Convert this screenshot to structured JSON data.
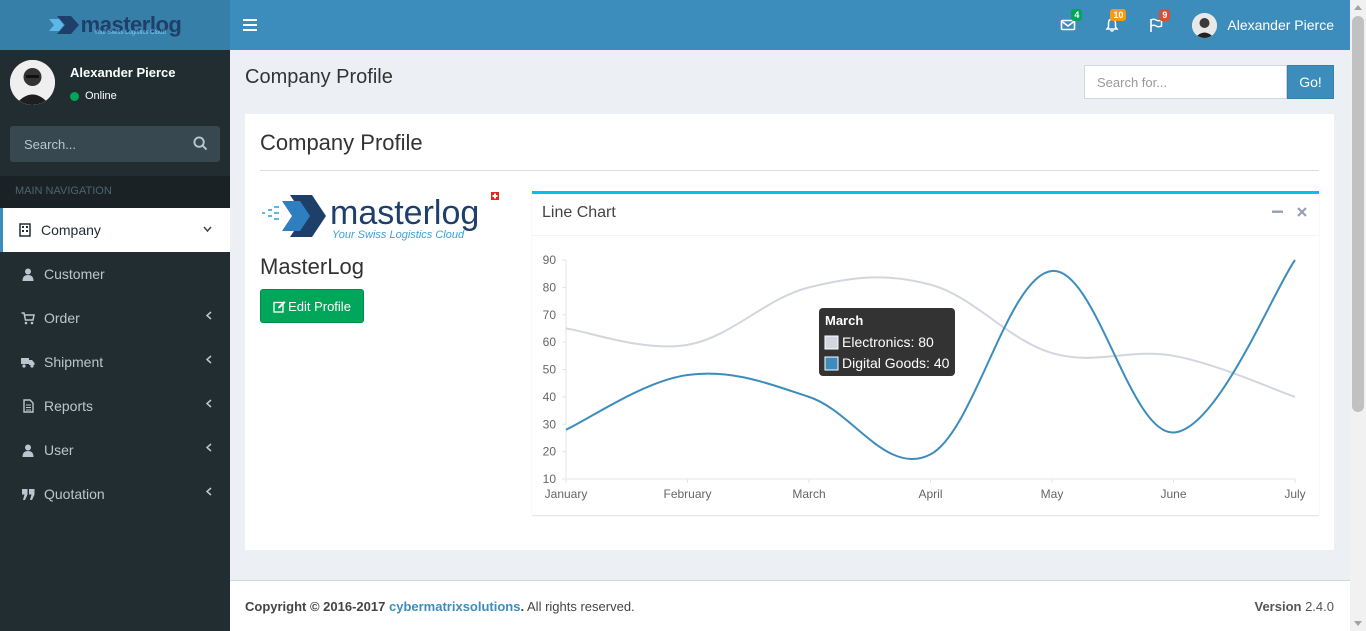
{
  "brand": {
    "name": "masterlog",
    "tagline": "Your Swiss Logistics Cloud"
  },
  "header": {
    "messages_count": "4",
    "notifications_count": "10",
    "flags_count": "9",
    "user_name": "Alexander Pierce"
  },
  "sidebar": {
    "user_name": "Alexander Pierce",
    "status": "Online",
    "search_placeholder": "Search...",
    "nav_header": "MAIN NAVIGATION",
    "items": [
      {
        "label": "Company",
        "icon": "building-icon",
        "active": true
      },
      {
        "label": "Customer",
        "icon": "user-icon"
      },
      {
        "label": "Order",
        "icon": "cart-icon"
      },
      {
        "label": "Shipment",
        "icon": "truck-icon"
      },
      {
        "label": "Reports",
        "icon": "document-icon"
      },
      {
        "label": "User",
        "icon": "user-icon"
      },
      {
        "label": "Quotation",
        "icon": "quote-icon"
      }
    ]
  },
  "page": {
    "title": "Company Profile",
    "search_placeholder": "Search for...",
    "search_button": "Go!"
  },
  "profile": {
    "box_title": "Company Profile",
    "company_name": "MasterLog",
    "edit_button": "Edit Profile"
  },
  "chart_box": {
    "title": "Line Chart"
  },
  "chart_data": {
    "type": "line",
    "categories": [
      "January",
      "February",
      "March",
      "April",
      "May",
      "June",
      "July"
    ],
    "series": [
      {
        "name": "Electronics",
        "values": [
          65,
          59,
          80,
          81,
          56,
          55,
          40
        ],
        "color": "#d2d6de"
      },
      {
        "name": "Digital Goods",
        "values": [
          28,
          48,
          40,
          19,
          86,
          27,
          90
        ],
        "color": "#3c8dbc"
      }
    ],
    "ylim": [
      10,
      90
    ],
    "yticks": [
      10,
      20,
      30,
      40,
      50,
      60,
      70,
      80,
      90
    ],
    "tooltip": {
      "title": "March",
      "lines": [
        "Electronics: 80",
        "Digital Goods: 40"
      ]
    }
  },
  "footer": {
    "copyright_prefix": "Copyright © 2016-2017",
    "company_link": "cybermatrixsolutions",
    "suffix": "All rights reserved.",
    "version_label": "Version",
    "version": "2.4.0"
  },
  "colors": {
    "header": "#3c8dbc",
    "sidebar": "#222d32",
    "success": "#00a65a",
    "info": "#00c0ef"
  }
}
